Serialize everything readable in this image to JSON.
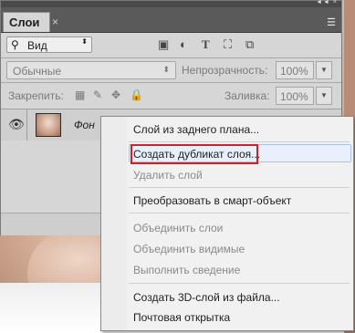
{
  "panel": {
    "tab_label": "Слои",
    "tab_close": "×",
    "titlebar_controls": "◄◄ ×",
    "menu_icon": "☰"
  },
  "filter": {
    "search_icon": "⚲",
    "kind_label": "Вид",
    "kind_arrow": "⬍",
    "icons": [
      "image-filter-icon",
      "adjustment-filter-icon",
      "type-filter-icon",
      "shape-filter-icon",
      "smart-object-filter-icon"
    ]
  },
  "blend": {
    "mode": "Обычные",
    "opacity_label": "Непрозрачность:",
    "opacity_value": "100%"
  },
  "lock": {
    "label": "Закрепить:",
    "fill_label": "Заливка:",
    "fill_value": "100%"
  },
  "layer": {
    "name": "Фон"
  },
  "context_menu": {
    "items": [
      {
        "label": "Слой из заднего плана..."
      },
      {
        "label": "Создать дубликат слоя..."
      },
      {
        "label": "Удалить слой"
      },
      {
        "label": "Преобразовать в смарт-объект"
      },
      {
        "label": "Объединить слои"
      },
      {
        "label": "Объединить видимые"
      },
      {
        "label": "Выполнить сведение"
      },
      {
        "label": "Создать 3D-слой из файла..."
      },
      {
        "label": "Почтовая открытка"
      }
    ]
  },
  "colors": {
    "highlight_box": "#d0202a",
    "panel_bg": "#d6d6d6",
    "tabbar": "#5a5a5a"
  }
}
